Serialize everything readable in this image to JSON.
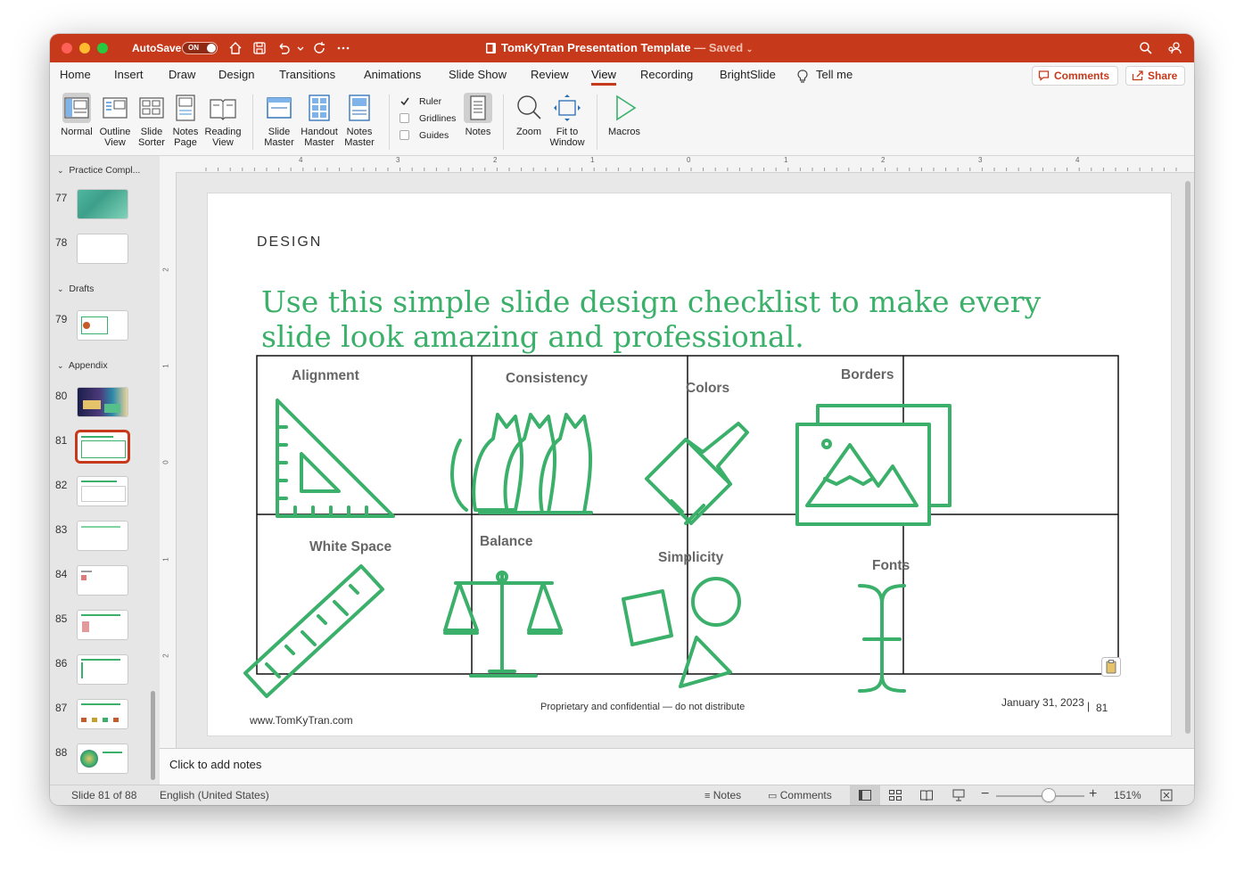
{
  "window": {
    "title": "TomKyTran Presentation Template",
    "title_suffix": "— Saved",
    "autosave_label": "AutoSave",
    "autosave_state": "ON"
  },
  "menu": {
    "items": [
      "Home",
      "Insert",
      "Draw",
      "Design",
      "Transitions",
      "Animations",
      "Slide Show",
      "Review",
      "View",
      "Recording",
      "BrightSlide"
    ],
    "active": "View",
    "tell_me": "Tell me",
    "comments_button": "Comments",
    "share_button": "Share"
  },
  "ribbon": {
    "normal": [
      "Normal"
    ],
    "outline": [
      "Outline",
      "View"
    ],
    "slide_sorter": [
      "Slide",
      "Sorter"
    ],
    "notes_page": [
      "Notes",
      "Page"
    ],
    "reading_view": [
      "Reading",
      "View"
    ],
    "slide_master": [
      "Slide",
      "Master"
    ],
    "handout_master": [
      "Handout",
      "Master"
    ],
    "notes_master": [
      "Notes",
      "Master"
    ],
    "ruler": "Ruler",
    "gridlines": "Gridlines",
    "guides": "Guides",
    "notes": "Notes",
    "zoom": "Zoom",
    "fit": [
      "Fit to",
      "Window"
    ],
    "macros": "Macros"
  },
  "sidebar": {
    "sections": [
      "Practice Compl...",
      "Drafts",
      "Appendix"
    ],
    "slides": [
      "77",
      "78",
      "79",
      "80",
      "81",
      "82",
      "83",
      "84",
      "85",
      "86",
      "87",
      "88"
    ],
    "selected": "81"
  },
  "ruler": {
    "h_labels": [
      "4",
      "3",
      "2",
      "1",
      "0",
      "1",
      "2",
      "3",
      "4"
    ],
    "v_labels": [
      "2",
      "1",
      "0",
      "1",
      "2"
    ]
  },
  "slide": {
    "section_label": "DESIGN",
    "title_line1": "Use this simple slide design checklist to make every",
    "title_line2": "slide look amazing and professional.",
    "cells": {
      "alignment": "Alignment",
      "consistency": "Consistency",
      "colors": "Colors",
      "borders": "Borders",
      "white_space": "White Space",
      "balance": "Balance",
      "simplicity": "Simplicity",
      "fonts": "Fonts"
    },
    "website": "www.TomKyTran.com",
    "confidential": "Proprietary and confidential — do not distribute",
    "date": "January 31, 2023",
    "page_number": "81",
    "accent_color": "#3bb06a"
  },
  "notes": {
    "placeholder": "Click to add notes"
  },
  "status": {
    "slide_info": "Slide 81 of 88",
    "language": "English (United States)",
    "notes": "Notes",
    "comments": "Comments",
    "zoom": "151%",
    "zoom_level": 0.6
  }
}
